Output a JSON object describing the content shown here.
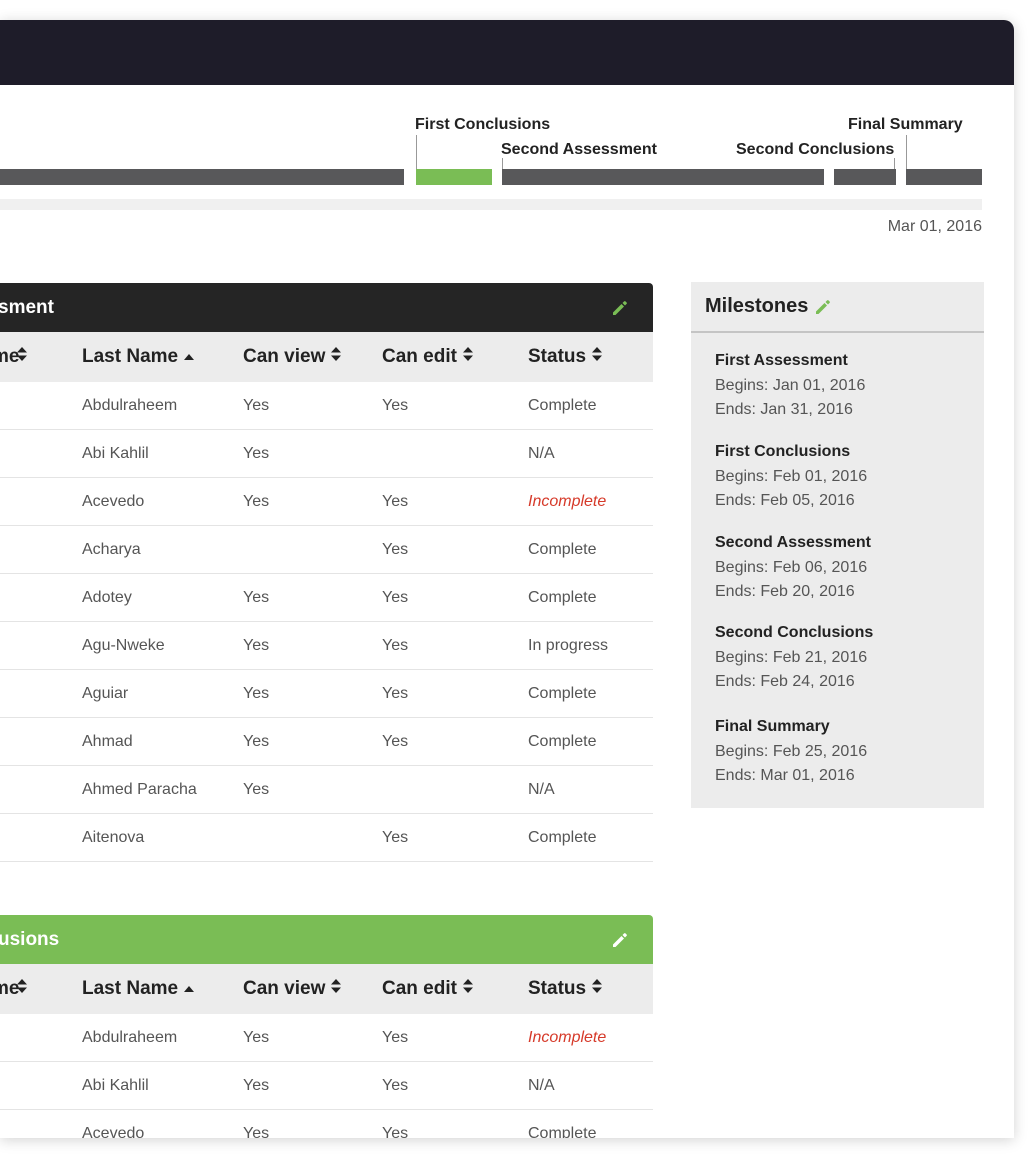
{
  "timeline": {
    "labels": {
      "first_conclusions": "First Conclusions",
      "second_assessment": "Second Assessment",
      "second_conclusions": "Second Conclusions",
      "final_summary": "Final Summary"
    },
    "end_date": "Mar 01, 2016",
    "active_phase": "First Conclusions"
  },
  "headers": {
    "col0": "me",
    "col1": "Last Name",
    "col2": "Can view",
    "col3": "Can edit",
    "col4": "Status"
  },
  "panel1": {
    "title": "sment",
    "rows": [
      {
        "last": "Abdulraheem",
        "view": "Yes",
        "edit": "Yes",
        "status": "Complete"
      },
      {
        "last": "Abi Kahlil",
        "view": "Yes",
        "edit": "",
        "status": "N/A"
      },
      {
        "last": "Acevedo",
        "view": "Yes",
        "edit": "Yes",
        "status": "Incomplete"
      },
      {
        "last": "Acharya",
        "view": "",
        "edit": "Yes",
        "status": "Complete"
      },
      {
        "last": "Adotey",
        "view": "Yes",
        "edit": "Yes",
        "status": "Complete"
      },
      {
        "last": "Agu-Nweke",
        "view": "Yes",
        "edit": "Yes",
        "status": "In progress"
      },
      {
        "last": "Aguiar",
        "view": "Yes",
        "edit": "Yes",
        "status": "Complete"
      },
      {
        "last": "Ahmad",
        "view": "Yes",
        "edit": "Yes",
        "status": "Complete"
      },
      {
        "last": "Ahmed Paracha",
        "view": "Yes",
        "edit": "",
        "status": "N/A"
      },
      {
        "last": "Aitenova",
        "view": "",
        "edit": "Yes",
        "status": "Complete"
      }
    ]
  },
  "panel2": {
    "title": "usions",
    "rows": [
      {
        "last": "Abdulraheem",
        "view": "Yes",
        "edit": "Yes",
        "status": "Incomplete"
      },
      {
        "last": "Abi Kahlil",
        "view": "Yes",
        "edit": "Yes",
        "status": "N/A"
      },
      {
        "last": "Acevedo",
        "view": "Yes",
        "edit": "Yes",
        "status": "Complete"
      }
    ]
  },
  "milestones": {
    "title": "Milestones",
    "items": [
      {
        "name": "First Assessment",
        "begins": "Begins: Jan 01, 2016",
        "ends": "Ends: Jan 31, 2016"
      },
      {
        "name": "First Conclusions",
        "begins": "Begins: Feb 01, 2016",
        "ends": "Ends: Feb 05, 2016"
      },
      {
        "name": "Second Assessment",
        "begins": "Begins: Feb 06, 2016",
        "ends": "Ends: Feb 20, 2016"
      },
      {
        "name": "Second Conclusions",
        "begins": "Begins: Feb 21, 2016",
        "ends": "Ends: Feb 24, 2016"
      },
      {
        "name": "Final Summary",
        "begins": "Begins: Feb 25, 2016",
        "ends": "Ends: Mar 01, 2016"
      }
    ]
  },
  "colors": {
    "accent_green": "#7abd55",
    "dark_header": "#252525",
    "topbar": "#1e1c29",
    "incomplete_red": "#d63a2a"
  },
  "icons": {
    "edit": "pencil-icon",
    "sort_both": "sort-icon",
    "sort_asc": "sort-asc-icon"
  }
}
